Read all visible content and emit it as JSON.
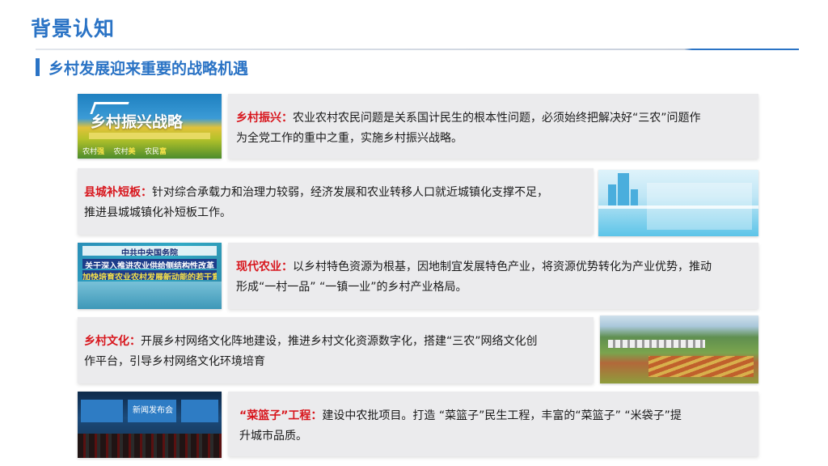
{
  "page": {
    "title": "背景认知",
    "subtitle": "乡村发展迎来重要的战略机遇"
  },
  "cards": [
    {
      "heading": "乡村振兴：",
      "body_l1": "农业农村农民问题是关系国计民生的根本性问题，必须始终把解决好“三农”问题作",
      "body_l2": "为全党工作的重中之重，实施乡村振兴战略。",
      "image": {
        "title": "乡村振兴战略",
        "foot_1": "农村",
        "foot_1b": "强",
        "foot_2": "农村",
        "foot_2b": "美",
        "foot_3": "农民",
        "foot_3b": "富"
      }
    },
    {
      "heading": "县城补短板：",
      "body_l1": "针对综合承载力和治理力较弱，经济发展和农业转移人口就近城镇化支撑不足，",
      "body_l2": "推进县城城镇化补短板工作。"
    },
    {
      "heading": "现代农业：",
      "body_l1": "以乡村特色资源为根基，因地制宜发展特色产业，将资源优势转化为产业优势，推动",
      "body_l2": "形成“一村一品” “一镇一业”的乡村产业格局。",
      "image": {
        "line_1": "中共中央国务院",
        "line_2": "关于深入推进农业供给侧结构性改革",
        "line_3": "加快培育农业农村发展新动能的若干意见"
      }
    },
    {
      "heading": "乡村文化：",
      "body_l1": "开展乡村网络文化阵地建设，推进乡村文化资源数字化，搭建“三农”网络文化创",
      "body_l2": "作平台，引导乡村网络文化环境培育"
    },
    {
      "heading": "“菜篮子”工程：",
      "body_l1": "建设中农批项目。打造 “菜篮子”民生工程，丰富的“菜篮子” “米袋子”提",
      "body_l2": "升城市品质。",
      "image": {
        "screen_text": "新闻发布会"
      }
    }
  ],
  "colors": {
    "accent": "#2a73c5",
    "highlight": "#d8161d",
    "card_bg": "#ebebed"
  }
}
